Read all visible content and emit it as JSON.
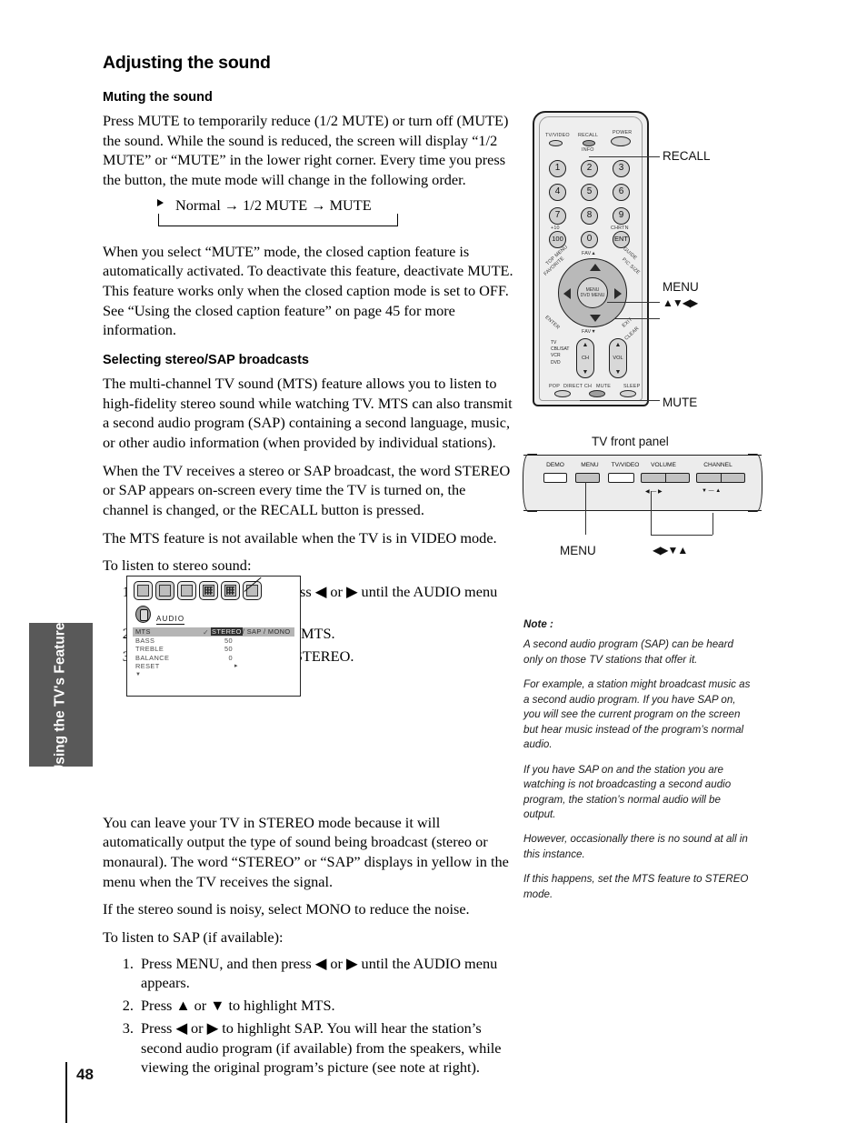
{
  "sidebar_tab": {
    "label": "Using the TV's\nFeatures"
  },
  "page": {
    "number": "48"
  },
  "main": {
    "section_title": "Adjusting the sound",
    "sub1": {
      "title": "Muting the sound",
      "p1": "Press MUTE to temporarily reduce (1/2 MUTE) or turn off (MUTE) the sound. While the sound is reduced, the screen will display “1/2 MUTE” or “MUTE” in the lower right corner. Every time you press the button, the mute mode will change in the following order.",
      "cycle": "Normal → 1/2 MUTE → MUTE",
      "p2": "When you select “MUTE” mode, the closed caption feature is automatically activated. To deactivate this feature, deactivate MUTE. This feature works only when the closed caption mode is set to OFF. See “Using the closed caption feature” on page 45 for more information."
    },
    "sub2": {
      "title": "Selecting stereo/SAP broadcasts",
      "p1": "The multi-channel TV sound (MTS) feature allows you to listen to high-fidelity stereo sound while watching TV. MTS can also transmit a second audio program (SAP) containing a second language, music, or other audio information (when provided by individual stations).",
      "p2": "When the TV receives a stereo or SAP broadcast, the word STEREO or SAP appears on-screen every time the TV is turned on, the channel is changed, or the RECALL button is pressed.",
      "p3": "The MTS feature is not available when the TV is in VIDEO mode.",
      "lead_stereo": "To listen to stereo sound:",
      "steps_stereo": [
        "Press MENU, and then press ◀ or ▶ until the AUDIO menu appears.",
        "Press ▲ or ▼ to highlight MTS.",
        "Press ◀ or ▶ to highlight STEREO."
      ],
      "p4": "You can leave your TV in STEREO mode because it will automatically output the type of sound being broadcast (stereo or monaural). The word “STEREO” or “SAP” displays in yellow in the menu when the TV receives the signal.",
      "p5": "If the stereo sound is noisy, select MONO to reduce the noise.",
      "lead_sap": "To listen to SAP (if available):",
      "steps_sap": [
        "Press MENU, and then press ◀ or ▶ until the AUDIO menu appears.",
        "Press ▲ or ▼ to highlight MTS.",
        "Press ◀ or ▶ to highlight SAP. You will hear the station’s second audio program (if available) from the speakers, while viewing the original program’s picture (see note at right)."
      ]
    }
  },
  "menu_screenshot": {
    "menu_name": "AUDIO",
    "rows": [
      {
        "label": "MTS",
        "value_selected": "STEREO",
        "value_rest": "/ SAP / MONO",
        "highlighted": true
      },
      {
        "label": "BASS",
        "value": "50"
      },
      {
        "label": "TREBLE",
        "value": "50"
      },
      {
        "label": "BALANCE",
        "value": "0"
      },
      {
        "label": "RESET",
        "value": "▸"
      }
    ]
  },
  "remote": {
    "top_buttons": [
      {
        "label": "TV/VIDEO"
      },
      {
        "label": "RECALL"
      },
      {
        "label": "POWER"
      }
    ],
    "info_label": "INFO",
    "keypad": [
      "1",
      "2",
      "3",
      "4",
      "5",
      "6",
      "7",
      "8",
      "9",
      "100",
      "0",
      "ENT"
    ],
    "keypad_aux": {
      "plus10": "+10",
      "chrtn": "CHRTN"
    },
    "ring_labels": {
      "top_menu": "TOP MENU",
      "favorite": "FAVORITE",
      "fav_up": "FAV▲",
      "guide": "GUIDE",
      "pic_size": "PIC SIZE",
      "enter": "ENTER",
      "fav_dn": "FAV▼",
      "exit": "EXIT",
      "clear": "CLEAR"
    },
    "center_button": {
      "line1": "MENU",
      "line2": "DVD MENU"
    },
    "mode_list": [
      "TV",
      "CBL/SAT",
      "VCR",
      "DVD"
    ],
    "rockers": [
      {
        "name": "CH"
      },
      {
        "name": "VOL"
      }
    ],
    "bottom_buttons": [
      "POP",
      "DIRECT CH",
      "MUTE",
      "SLEEP"
    ],
    "callouts": [
      {
        "label": "RECALL"
      },
      {
        "label": "MENU"
      },
      {
        "label": "▲▼◀▶"
      },
      {
        "label": "MUTE"
      }
    ]
  },
  "front_panel": {
    "title": "TV front panel",
    "buttons": [
      "DEMO",
      "MENU",
      "TV/VIDEO",
      "VOLUME",
      "CHANNEL"
    ],
    "arrow_hints": {
      "volume": "◀ — ▶",
      "channel": "▼ — ▲"
    },
    "callouts": [
      {
        "label": "MENU"
      },
      {
        "label": "◀▶▼▲"
      }
    ]
  },
  "note": {
    "heading": "Note :",
    "paragraphs": [
      "A second audio program (SAP) can be heard only on those TV stations that offer it.",
      "For example, a station might broadcast music as a second audio program. If you have SAP on, you will see the current program on the screen but hear music instead of the program’s normal audio.",
      "If you have SAP on and the station you are watching is not broadcasting a second audio program, the station’s normal audio will be output.",
      "However, occasionally there is no sound at all in this instance.",
      "If this happens, set the MTS feature to STEREO mode."
    ]
  }
}
